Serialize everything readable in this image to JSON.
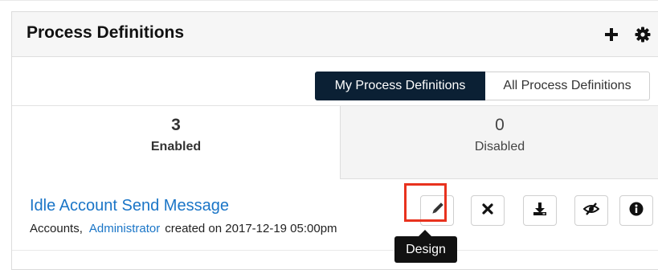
{
  "dashlet": {
    "title": "Process Definitions",
    "header_icons": [
      "plus-icon",
      "gear-icon"
    ]
  },
  "filter_toggle": {
    "options": [
      "My Process Definitions",
      "All Process Definitions"
    ],
    "selected": "My Process Definitions"
  },
  "tabs": [
    {
      "count": "3",
      "label": "Enabled",
      "active": true
    },
    {
      "count": "0",
      "label": "Disabled",
      "active": false
    }
  ],
  "records": [
    {
      "name": "Idle Account Send Message",
      "module": "Accounts,",
      "user": "Administrator",
      "created_text": "created on 2017-12-19 05:00pm",
      "actions": [
        "pencil-icon",
        "close-icon",
        "download-icon",
        "eye-slash-icon",
        "info-icon"
      ]
    }
  ],
  "tooltip": {
    "text": "Design"
  },
  "colors": {
    "active_toggle_bg": "#0b2034",
    "link": "#1a75c7",
    "highlight": "#e8321e",
    "tooltip_bg": "#111111"
  }
}
